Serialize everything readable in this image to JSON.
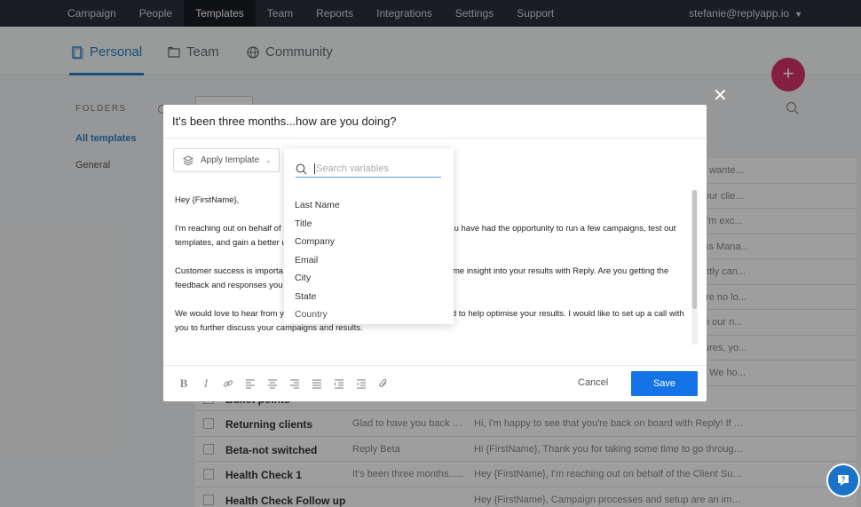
{
  "nav": {
    "items": [
      {
        "label": "Campaign",
        "active": false
      },
      {
        "label": "People",
        "active": false
      },
      {
        "label": "Templates",
        "active": true
      },
      {
        "label": "Team",
        "active": false
      },
      {
        "label": "Reports",
        "active": false
      },
      {
        "label": "Integrations",
        "active": false
      },
      {
        "label": "Settings",
        "active": false
      },
      {
        "label": "Support",
        "active": false
      }
    ],
    "user_email": "stefanie@replyapp.io"
  },
  "subtabs": {
    "personal": "Personal",
    "team": "Team",
    "community": "Community",
    "active_color": "#2a82c8"
  },
  "sidebar": {
    "folders_title": "FOLDERS",
    "items": [
      {
        "label": "All templates",
        "active": true
      },
      {
        "label": "General",
        "active": false
      }
    ]
  },
  "fab": {
    "label": "+",
    "color": "#d6326a"
  },
  "bg_table": {
    "rows": [
      {
        "name": "",
        "subject": "",
        "preview": "",
        "tail": "t wante..."
      },
      {
        "name": "",
        "subject": "",
        "preview": "",
        "tail": "our clie..."
      },
      {
        "name": "",
        "subject": "",
        "preview": "",
        "tail": "I'm exc..."
      },
      {
        "name": "",
        "subject": "",
        "preview": "",
        "tail": "ss Mana..."
      },
      {
        "name": "",
        "subject": "",
        "preview": "",
        "tail": "ntly can..."
      },
      {
        "name": "",
        "subject": "",
        "preview": "",
        "tail": "'re no lo..."
      },
      {
        "name": "",
        "subject": "",
        "preview": "",
        "tail": "h our n..."
      },
      {
        "name": "",
        "subject": "",
        "preview": "",
        "tail": "ures, yo..."
      },
      {
        "name": "",
        "subject": "",
        "preview": "",
        "tail": ". We ho..."
      },
      {
        "name": "Bullet points",
        "subject": "",
        "preview": "",
        "tail": ""
      },
      {
        "name": "Returning clients",
        "subject": "Glad to have you back at ...",
        "preview": "Hi, I'm happy to see that you're back on board with Reply! If you ha...",
        "tail": ""
      },
      {
        "name": "Beta-not switched",
        "subject": "Reply Beta",
        "preview": "Hi {FirstName}, Thank you for taking some time to go through a de...",
        "tail": ""
      },
      {
        "name": "Health Check 1",
        "subject": "It's been three months...h...",
        "preview": "Hey {FirstName}, I'm reaching out on behalf of the Client Success t...",
        "tail": ""
      },
      {
        "name": "Health Check Follow up",
        "subject": "",
        "preview": "Hey {FirstName}, Campaign processes and setup are an important ...",
        "tail": ""
      }
    ]
  },
  "modal": {
    "title": "It's been three months...how are you doing?",
    "apply_template_label": "Apply template",
    "body_paragraphs": [
      [
        "Hey {FirstName},"
      ],
      [
        "I'm reaching out on behalf of",
        "u have had the opportunity to run a few campaigns, test out",
        "templates, and gain a better u"
      ],
      [
        "Customer success is importa",
        "some insight into your results with Reply. Are you getting the",
        "feedback and responses you"
      ],
      [
        "We would love to hear from y",
        "d to help optimise your results. I would like to set up a call with",
        "you to further discuss your campaigns and results."
      ]
    ],
    "cancel_label": "Cancel",
    "save_label": "Save",
    "save_color": "#1473e6"
  },
  "variables": {
    "search_placeholder": "Search variables",
    "items": [
      "Last Name",
      "Title",
      "Company",
      "Email",
      "City",
      "State",
      "Country"
    ]
  },
  "toolbar_icons": [
    "bold-icon",
    "italic-icon",
    "link-icon",
    "align-left-icon",
    "align-center-icon",
    "align-right-icon",
    "justify-icon",
    "indent-icon",
    "outdent-icon",
    "attachment-icon"
  ]
}
